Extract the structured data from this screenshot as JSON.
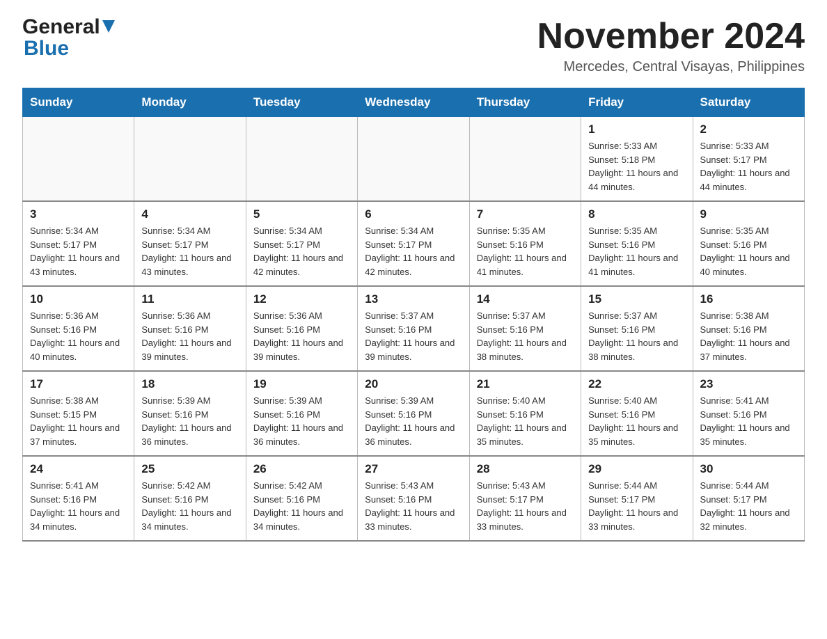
{
  "header": {
    "logo": {
      "general": "General",
      "blue": "Blue",
      "aria": "GeneralBlue logo"
    },
    "title": "November 2024",
    "location": "Mercedes, Central Visayas, Philippines"
  },
  "weekdays": [
    "Sunday",
    "Monday",
    "Tuesday",
    "Wednesday",
    "Thursday",
    "Friday",
    "Saturday"
  ],
  "weeks": [
    [
      {
        "day": "",
        "sunrise": "",
        "sunset": "",
        "daylight": ""
      },
      {
        "day": "",
        "sunrise": "",
        "sunset": "",
        "daylight": ""
      },
      {
        "day": "",
        "sunrise": "",
        "sunset": "",
        "daylight": ""
      },
      {
        "day": "",
        "sunrise": "",
        "sunset": "",
        "daylight": ""
      },
      {
        "day": "",
        "sunrise": "",
        "sunset": "",
        "daylight": ""
      },
      {
        "day": "1",
        "sunrise": "Sunrise: 5:33 AM",
        "sunset": "Sunset: 5:18 PM",
        "daylight": "Daylight: 11 hours and 44 minutes."
      },
      {
        "day": "2",
        "sunrise": "Sunrise: 5:33 AM",
        "sunset": "Sunset: 5:17 PM",
        "daylight": "Daylight: 11 hours and 44 minutes."
      }
    ],
    [
      {
        "day": "3",
        "sunrise": "Sunrise: 5:34 AM",
        "sunset": "Sunset: 5:17 PM",
        "daylight": "Daylight: 11 hours and 43 minutes."
      },
      {
        "day": "4",
        "sunrise": "Sunrise: 5:34 AM",
        "sunset": "Sunset: 5:17 PM",
        "daylight": "Daylight: 11 hours and 43 minutes."
      },
      {
        "day": "5",
        "sunrise": "Sunrise: 5:34 AM",
        "sunset": "Sunset: 5:17 PM",
        "daylight": "Daylight: 11 hours and 42 minutes."
      },
      {
        "day": "6",
        "sunrise": "Sunrise: 5:34 AM",
        "sunset": "Sunset: 5:17 PM",
        "daylight": "Daylight: 11 hours and 42 minutes."
      },
      {
        "day": "7",
        "sunrise": "Sunrise: 5:35 AM",
        "sunset": "Sunset: 5:16 PM",
        "daylight": "Daylight: 11 hours and 41 minutes."
      },
      {
        "day": "8",
        "sunrise": "Sunrise: 5:35 AM",
        "sunset": "Sunset: 5:16 PM",
        "daylight": "Daylight: 11 hours and 41 minutes."
      },
      {
        "day": "9",
        "sunrise": "Sunrise: 5:35 AM",
        "sunset": "Sunset: 5:16 PM",
        "daylight": "Daylight: 11 hours and 40 minutes."
      }
    ],
    [
      {
        "day": "10",
        "sunrise": "Sunrise: 5:36 AM",
        "sunset": "Sunset: 5:16 PM",
        "daylight": "Daylight: 11 hours and 40 minutes."
      },
      {
        "day": "11",
        "sunrise": "Sunrise: 5:36 AM",
        "sunset": "Sunset: 5:16 PM",
        "daylight": "Daylight: 11 hours and 39 minutes."
      },
      {
        "day": "12",
        "sunrise": "Sunrise: 5:36 AM",
        "sunset": "Sunset: 5:16 PM",
        "daylight": "Daylight: 11 hours and 39 minutes."
      },
      {
        "day": "13",
        "sunrise": "Sunrise: 5:37 AM",
        "sunset": "Sunset: 5:16 PM",
        "daylight": "Daylight: 11 hours and 39 minutes."
      },
      {
        "day": "14",
        "sunrise": "Sunrise: 5:37 AM",
        "sunset": "Sunset: 5:16 PM",
        "daylight": "Daylight: 11 hours and 38 minutes."
      },
      {
        "day": "15",
        "sunrise": "Sunrise: 5:37 AM",
        "sunset": "Sunset: 5:16 PM",
        "daylight": "Daylight: 11 hours and 38 minutes."
      },
      {
        "day": "16",
        "sunrise": "Sunrise: 5:38 AM",
        "sunset": "Sunset: 5:16 PM",
        "daylight": "Daylight: 11 hours and 37 minutes."
      }
    ],
    [
      {
        "day": "17",
        "sunrise": "Sunrise: 5:38 AM",
        "sunset": "Sunset: 5:15 PM",
        "daylight": "Daylight: 11 hours and 37 minutes."
      },
      {
        "day": "18",
        "sunrise": "Sunrise: 5:39 AM",
        "sunset": "Sunset: 5:16 PM",
        "daylight": "Daylight: 11 hours and 36 minutes."
      },
      {
        "day": "19",
        "sunrise": "Sunrise: 5:39 AM",
        "sunset": "Sunset: 5:16 PM",
        "daylight": "Daylight: 11 hours and 36 minutes."
      },
      {
        "day": "20",
        "sunrise": "Sunrise: 5:39 AM",
        "sunset": "Sunset: 5:16 PM",
        "daylight": "Daylight: 11 hours and 36 minutes."
      },
      {
        "day": "21",
        "sunrise": "Sunrise: 5:40 AM",
        "sunset": "Sunset: 5:16 PM",
        "daylight": "Daylight: 11 hours and 35 minutes."
      },
      {
        "day": "22",
        "sunrise": "Sunrise: 5:40 AM",
        "sunset": "Sunset: 5:16 PM",
        "daylight": "Daylight: 11 hours and 35 minutes."
      },
      {
        "day": "23",
        "sunrise": "Sunrise: 5:41 AM",
        "sunset": "Sunset: 5:16 PM",
        "daylight": "Daylight: 11 hours and 35 minutes."
      }
    ],
    [
      {
        "day": "24",
        "sunrise": "Sunrise: 5:41 AM",
        "sunset": "Sunset: 5:16 PM",
        "daylight": "Daylight: 11 hours and 34 minutes."
      },
      {
        "day": "25",
        "sunrise": "Sunrise: 5:42 AM",
        "sunset": "Sunset: 5:16 PM",
        "daylight": "Daylight: 11 hours and 34 minutes."
      },
      {
        "day": "26",
        "sunrise": "Sunrise: 5:42 AM",
        "sunset": "Sunset: 5:16 PM",
        "daylight": "Daylight: 11 hours and 34 minutes."
      },
      {
        "day": "27",
        "sunrise": "Sunrise: 5:43 AM",
        "sunset": "Sunset: 5:16 PM",
        "daylight": "Daylight: 11 hours and 33 minutes."
      },
      {
        "day": "28",
        "sunrise": "Sunrise: 5:43 AM",
        "sunset": "Sunset: 5:17 PM",
        "daylight": "Daylight: 11 hours and 33 minutes."
      },
      {
        "day": "29",
        "sunrise": "Sunrise: 5:44 AM",
        "sunset": "Sunset: 5:17 PM",
        "daylight": "Daylight: 11 hours and 33 minutes."
      },
      {
        "day": "30",
        "sunrise": "Sunrise: 5:44 AM",
        "sunset": "Sunset: 5:17 PM",
        "daylight": "Daylight: 11 hours and 32 minutes."
      }
    ]
  ]
}
